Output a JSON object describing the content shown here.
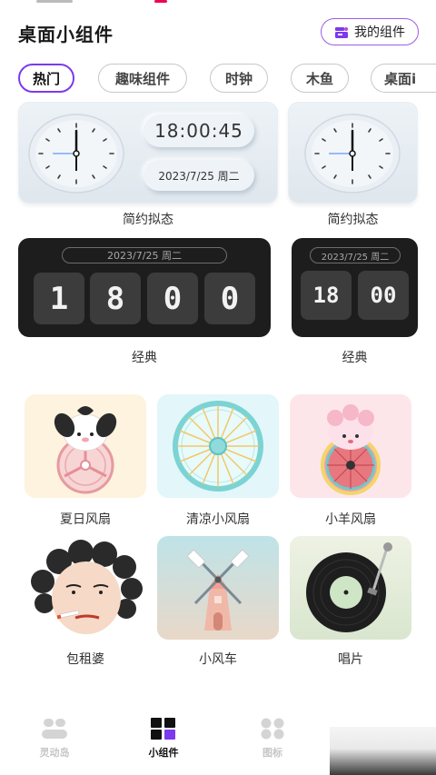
{
  "header": {
    "title": "桌面小组件",
    "my_widgets_label": "我的组件"
  },
  "tabs": [
    {
      "label": "热门",
      "active": true
    },
    {
      "label": "趣味组件",
      "active": false
    },
    {
      "label": "时钟",
      "active": false
    },
    {
      "label": "木鱼",
      "active": false
    },
    {
      "label": "桌面i",
      "active": false
    }
  ],
  "clock_widgets": {
    "neo_large": {
      "time": "18:00:45",
      "date": "2023/7/25 周二",
      "label": "简约拟态"
    },
    "neo_small": {
      "label": "简约拟态"
    },
    "flip_large": {
      "date": "2023/7/25 周二",
      "digits": [
        "1",
        "8",
        "0",
        "0"
      ],
      "label": "经典"
    },
    "flip_small": {
      "date": "2023/7/25 周二",
      "digits": [
        "18",
        "00"
      ],
      "label": "经典"
    }
  },
  "grid_tiles": [
    {
      "label": "夏日风扇",
      "icon": "pink-fan-puppy-icon"
    },
    {
      "label": "清凉小风扇",
      "icon": "blue-fan-icon"
    },
    {
      "label": "小羊风扇",
      "icon": "sheep-fan-icon"
    },
    {
      "label": "包租婆",
      "icon": "landlady-face-icon"
    },
    {
      "label": "小风车",
      "icon": "windmill-icon"
    },
    {
      "label": "唱片",
      "icon": "vinyl-record-icon"
    }
  ],
  "bottom_nav": [
    {
      "label": "灵动岛",
      "active": false,
      "icon": "island-icon"
    },
    {
      "label": "小组件",
      "active": true,
      "icon": "widgets-grid-icon"
    },
    {
      "label": "图标",
      "active": false,
      "icon": "icons-grid-icon"
    }
  ],
  "colors": {
    "accent_purple": "#7c3aed",
    "dark_widget": "#1d1d1d",
    "digit_box": "#3c3c3c"
  }
}
